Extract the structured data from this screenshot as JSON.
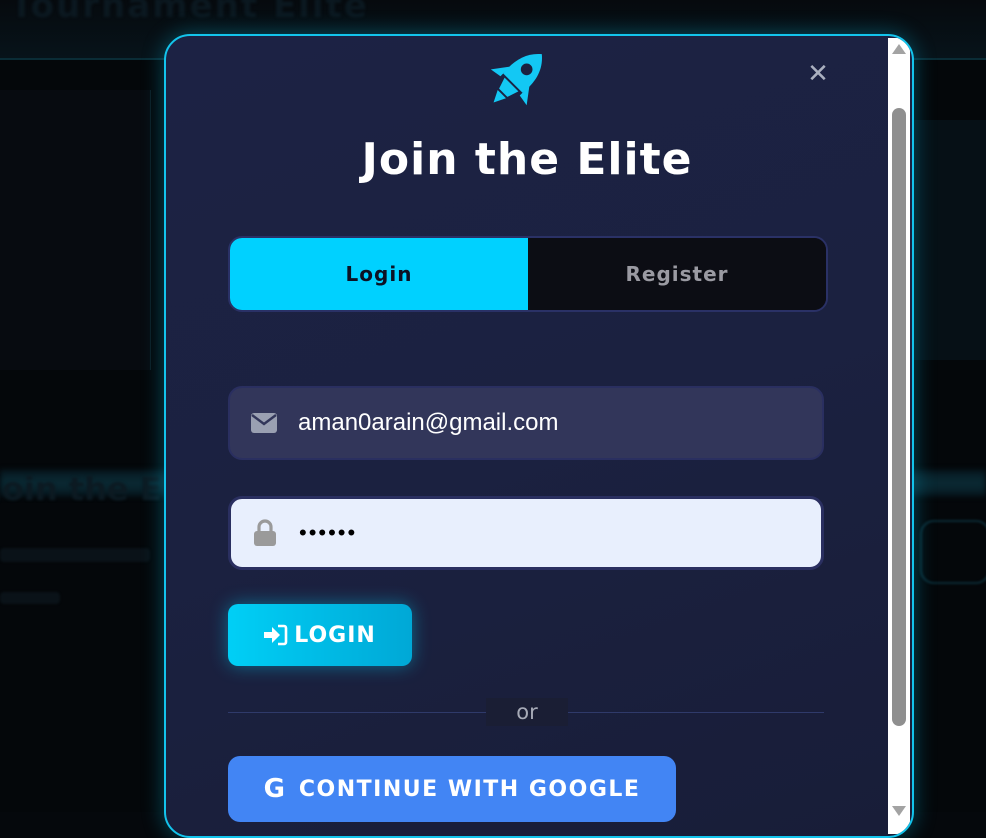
{
  "background": {
    "heading": "Tournament Elite",
    "subheading": "Join the Elite"
  },
  "modal": {
    "title": "Join the Elite",
    "close_glyph": "✕",
    "logo_icon": "rocket-icon",
    "tabs": [
      {
        "label": "Login",
        "active": true
      },
      {
        "label": "Register",
        "active": false
      }
    ],
    "email": {
      "icon": "envelope-icon",
      "value": "aman0arain@gmail.com"
    },
    "password": {
      "icon": "lock-icon",
      "value": "••••••"
    },
    "login_button": {
      "icon": "sign-in-icon",
      "label": "LOGIN"
    },
    "divider_label": "or",
    "google_button": {
      "icon_glyph": "G",
      "label": "CONTINUE WITH GOOGLE"
    }
  },
  "colors": {
    "accent": "#00d1ff",
    "modal_border": "#13c4ec",
    "google_blue": "#4285f4",
    "modal_bg": "#1b2140"
  }
}
